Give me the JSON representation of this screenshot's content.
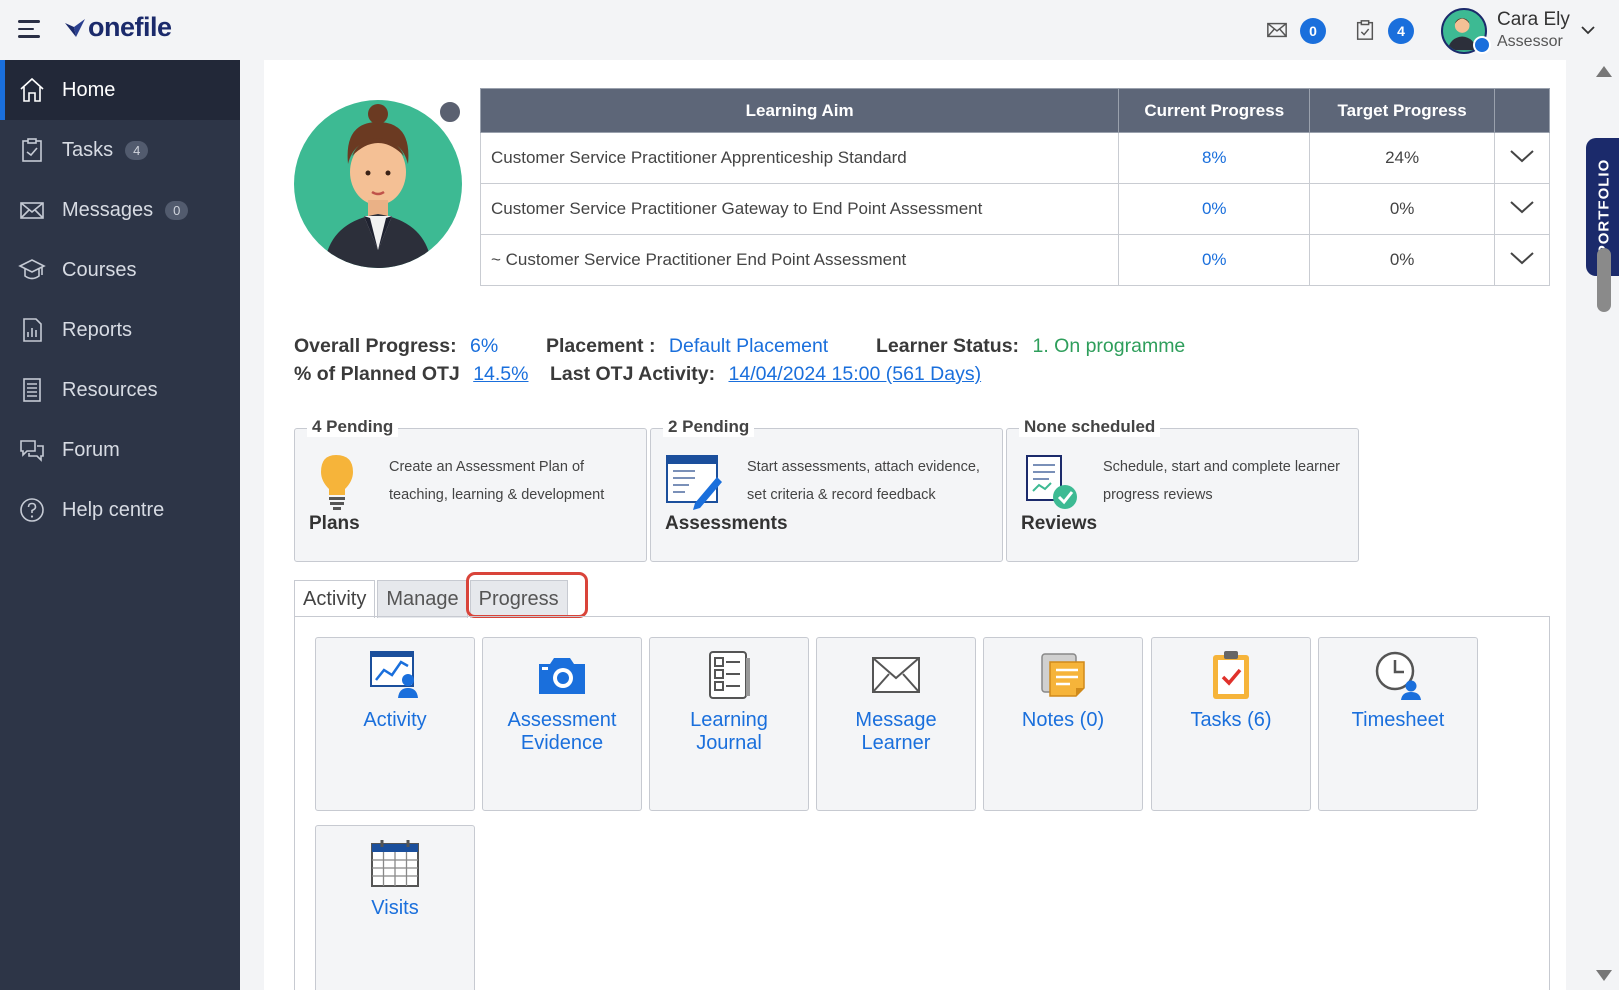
{
  "header": {
    "logo_text": "onefile",
    "messages_count": "0",
    "tasks_count": "4",
    "user_name": "Cara Ely",
    "user_role": "Assessor"
  },
  "sidebar": {
    "items": [
      {
        "label": "Home",
        "icon": "home-icon",
        "active": true
      },
      {
        "label": "Tasks",
        "icon": "clipboard-icon",
        "count": "4"
      },
      {
        "label": "Messages",
        "icon": "envelope-icon",
        "count": "0"
      },
      {
        "label": "Courses",
        "icon": "graduation-cap-icon"
      },
      {
        "label": "Reports",
        "icon": "report-icon"
      },
      {
        "label": "Resources",
        "icon": "resources-icon"
      },
      {
        "label": "Forum",
        "icon": "chat-bubbles-icon"
      },
      {
        "label": "Help centre",
        "icon": "help-icon"
      }
    ]
  },
  "aims_table": {
    "headers": [
      "Learning Aim",
      "Current Progress",
      "Target Progress"
    ],
    "rows": [
      {
        "aim": "Customer Service Practitioner Apprenticeship Standard",
        "current": "8%",
        "target": "24%"
      },
      {
        "aim": "Customer Service Practitioner Gateway to End Point Assessment",
        "current": "0%",
        "target": "0%"
      },
      {
        "aim": "~ Customer Service Practitioner End Point Assessment",
        "current": "0%",
        "target": "0%"
      }
    ]
  },
  "stats": {
    "overall_label": "Overall Progress:",
    "overall_value": "6%",
    "placement_label": "Placement :",
    "placement_value": "Default Placement",
    "status_label": "Learner Status:",
    "status_value": "1. On programme",
    "otj_label": "% of Planned OTJ",
    "otj_value": "14.5%",
    "last_otj_label": "Last OTJ Activity:",
    "last_otj_value": "14/04/2024 15:00 (561 Days)"
  },
  "feature_boxes": [
    {
      "legend": "4 Pending",
      "title": "Plans",
      "desc": "Create an Assessment Plan of teaching, learning & development"
    },
    {
      "legend": "2 Pending",
      "title": "Assessments",
      "desc": "Start assessments, attach evidence, set criteria & record feedback"
    },
    {
      "legend": "None scheduled",
      "title": "Reviews",
      "desc": "Schedule, start and complete learner progress reviews"
    }
  ],
  "tabs": [
    "Activity",
    "Manage",
    "Progress"
  ],
  "tiles": [
    {
      "label": "Activity"
    },
    {
      "label": "Assessment Evidence"
    },
    {
      "label": "Learning Journal"
    },
    {
      "label": "Message Learner"
    },
    {
      "label": "Notes (0)"
    },
    {
      "label": "Tasks (6)"
    },
    {
      "label": "Timesheet"
    },
    {
      "label": "Visits"
    }
  ],
  "portfolio_tab": "PORTFOLIO",
  "colors": {
    "brand_navy": "#1b2a6b",
    "link_blue": "#1a6fdc",
    "sidebar_bg": "#2d3547",
    "status_green": "#2e9e5b",
    "highlight_red": "#d9443a"
  }
}
